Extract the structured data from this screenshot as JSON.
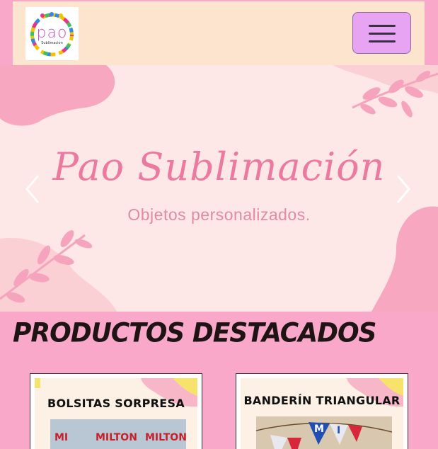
{
  "brand": {
    "logo_text": "pao",
    "logo_subtext": "Sublimación"
  },
  "navbar": {
    "menu_button_label": "Toggle navigation"
  },
  "hero": {
    "title": "Pao Sublimación",
    "subtitle": "Objetos personalizados.",
    "prev_label": "Previous",
    "next_label": "Next"
  },
  "products": {
    "section_title": "PRODUCTOS DESTACADOS",
    "items": [
      {
        "title": "BOLSITAS SORPRESA",
        "photo_tags": [
          "MI",
          "MILTON",
          "MILTON"
        ]
      },
      {
        "title": "BANDERÍN TRIANGULAR",
        "photo_tags": [
          "M",
          "I"
        ]
      }
    ]
  },
  "colors": {
    "page_bg": "#f9a8c9",
    "navbar_bg": "#fde4cf",
    "menu_button_bg": "#e6a4f2",
    "hero_bg": "#fde8e7",
    "hero_text": "#ec7aa0"
  }
}
